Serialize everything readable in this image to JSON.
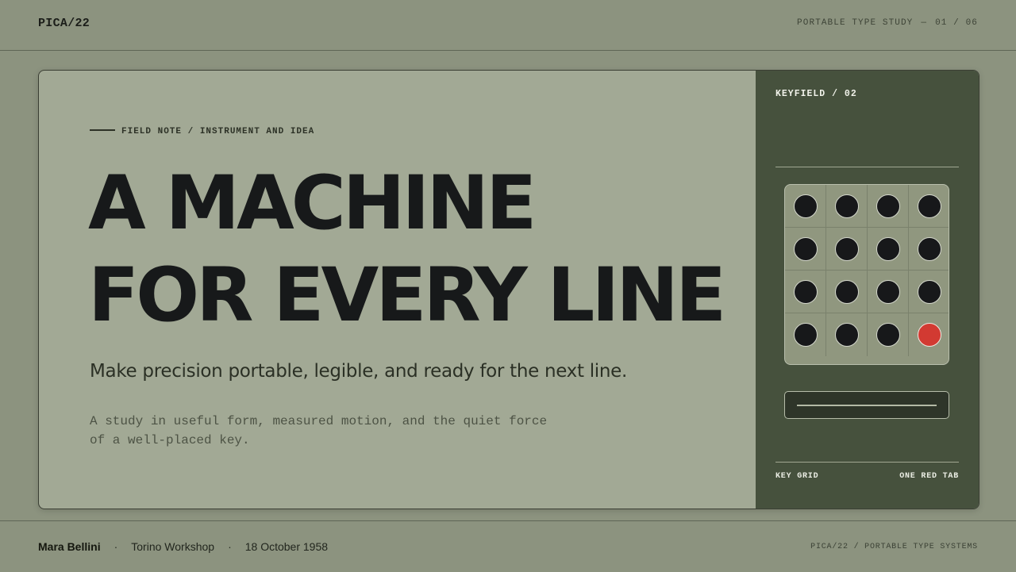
{
  "header": {
    "brand": "PICA/22",
    "section": "PORTABLE TYPE STUDY",
    "separator": "—",
    "page_indicator": "01 / 06"
  },
  "hero": {
    "kicker": "FIELD NOTE / INSTRUMENT AND IDEA",
    "headline_lines": [
      "A MACHINE",
      "FOR EVERY LINE"
    ],
    "subhead": "Make precision portable, legible, and ready for the next line.",
    "body_lines": [
      "A study in useful form, measured motion, and the quiet force",
      "of a well-placed key."
    ]
  },
  "keyfield": {
    "title": "KEYFIELD / 02",
    "rows": 4,
    "cols": 4,
    "highlight_key": {
      "row": 4,
      "col": 4,
      "color": "#d23a32"
    },
    "footer_left": "KEY GRID",
    "footer_right": "ONE RED TAB"
  },
  "footer": {
    "author": "Mara Bellini",
    "dot": "·",
    "venue": "Torino Workshop",
    "date": "18 October 1958",
    "colophon": "PICA/22 / PORTABLE TYPE SYSTEMS"
  },
  "colors": {
    "page_background": "#8c937f",
    "card_background": "#a2a995",
    "panel_background": "#46513d",
    "ink": "#17191a",
    "accent_red": "#d23a32"
  }
}
